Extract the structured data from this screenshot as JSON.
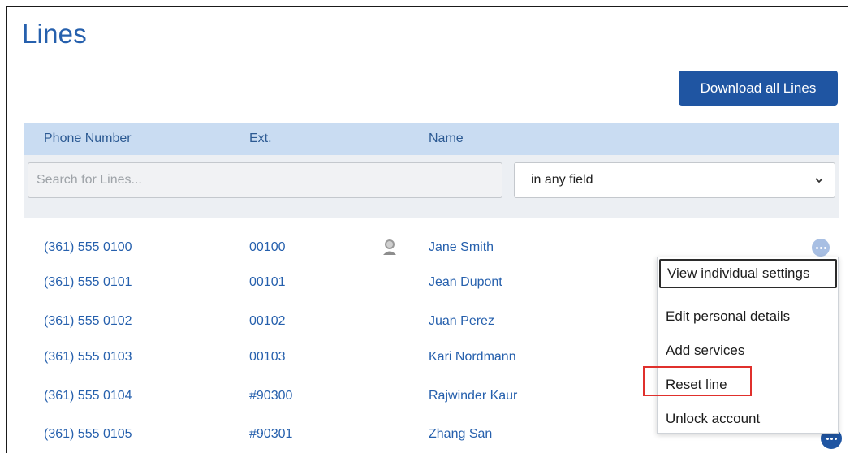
{
  "page": {
    "title": "Lines"
  },
  "toolbar": {
    "download_label": "Download all Lines"
  },
  "table": {
    "columns": [
      "Phone Number",
      "Ext.",
      "Name"
    ],
    "filter": {
      "search_placeholder": "Search for Lines...",
      "field_option": "in any field"
    },
    "rows": [
      {
        "phone": "(361) 555 0100",
        "ext": "00100",
        "name": "Jane Smith",
        "has_user_icon": true
      },
      {
        "phone": "(361) 555 0101",
        "ext": "00101",
        "name": "Jean Dupont"
      },
      {
        "phone": "(361) 555 0102",
        "ext": "00102",
        "name": "Juan Perez"
      },
      {
        "phone": "(361) 555 0103",
        "ext": "00103",
        "name": "Kari Nordmann"
      },
      {
        "phone": "(361) 555 0104",
        "ext": "#90300",
        "name": "Rajwinder Kaur"
      },
      {
        "phone": "(361) 555 0105",
        "ext": "#90301",
        "name": "Zhang San"
      }
    ]
  },
  "context_menu": {
    "items": [
      "View individual settings",
      "Edit personal details",
      "Add services",
      "Reset line",
      "Unlock account"
    ],
    "focused_index": 0,
    "highlighted_index": 3
  },
  "colors": {
    "accent": "#2660ad",
    "button": "#1f55a2",
    "header_bg": "#c9dcf2",
    "highlight": "#e0302c"
  }
}
